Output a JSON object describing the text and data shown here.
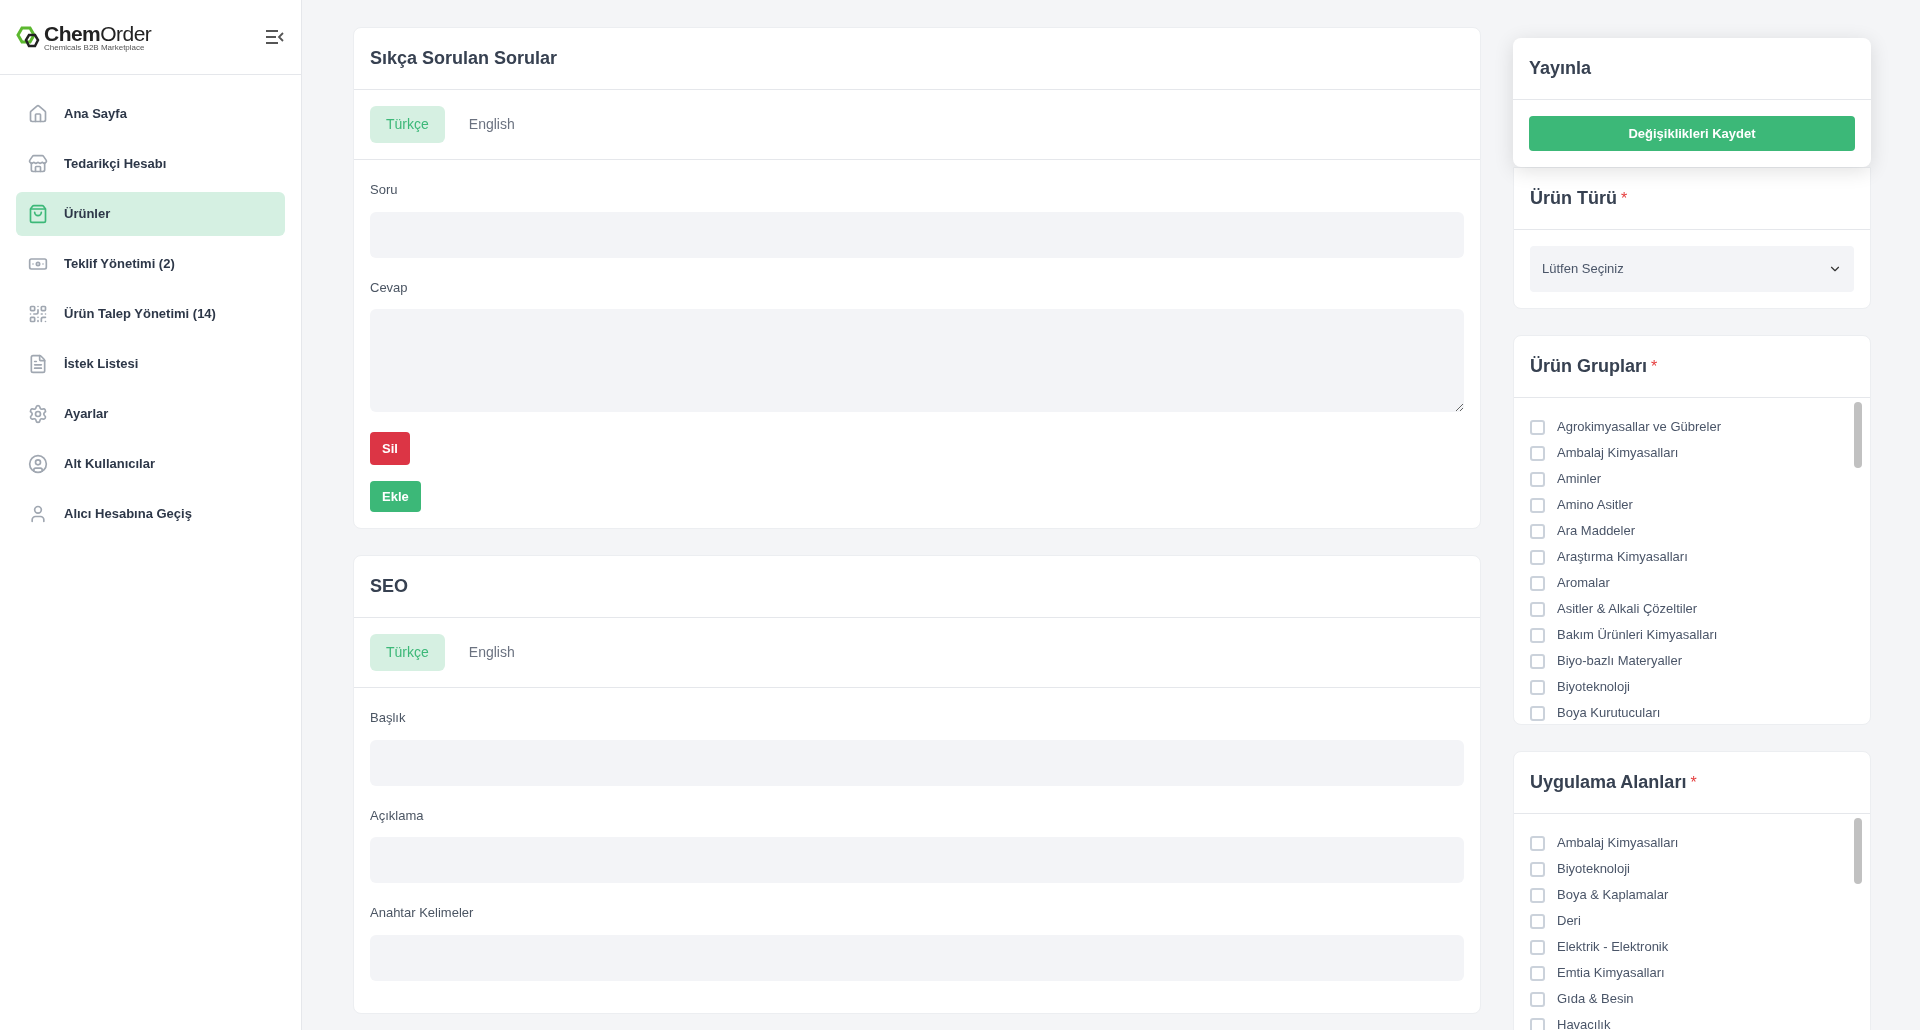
{
  "logo": {
    "name_bold": "Chem",
    "name_light": "Order",
    "tagline": "Chemicals B2B Marketplace"
  },
  "sidebar": {
    "items": [
      {
        "label": "Ana Sayfa",
        "selected": false
      },
      {
        "label": "Tedarikçi Hesabı",
        "selected": false
      },
      {
        "label": "Ürünler",
        "selected": true
      },
      {
        "label": "Teklif Yönetimi (2)",
        "selected": false
      },
      {
        "label": "Ürün Talep Yönetimi (14)",
        "selected": false
      },
      {
        "label": "İstek Listesi",
        "selected": false
      },
      {
        "label": "Ayarlar",
        "selected": false
      },
      {
        "label": "Alt Kullanıcılar",
        "selected": false
      },
      {
        "label": "Alıcı Hesabına Geçiş",
        "selected": false
      }
    ]
  },
  "faq": {
    "title": "Sıkça Sorulan Sorular",
    "tabs": [
      {
        "label": "Türkçe",
        "selected": true
      },
      {
        "label": "English",
        "selected": false
      }
    ],
    "fields": [
      {
        "label": "Soru",
        "kind": "input"
      },
      {
        "label": "Cevap",
        "kind": "textarea"
      }
    ],
    "delete_button": "Sil",
    "add_button": "Ekle"
  },
  "seo": {
    "title": "SEO",
    "tabs": [
      {
        "label": "Türkçe",
        "selected": true
      },
      {
        "label": "English",
        "selected": false
      }
    ],
    "fields": [
      {
        "label": "Başlık",
        "kind": "input"
      },
      {
        "label": "Açıklama",
        "kind": "input"
      },
      {
        "label": "Anahtar Kelimeler",
        "kind": "input"
      }
    ]
  },
  "publish": {
    "title": "Yayınla",
    "button": "Değişiklikleri Kaydet"
  },
  "product_type": {
    "title": "Ürün Türü",
    "required_mark": "*",
    "select_value": "Lütfen Seçiniz"
  },
  "product_groups": {
    "title": "Ürün Grupları",
    "required_mark": "*",
    "options": [
      {
        "label": "Agrokimyasallar ve Gübreler",
        "checked": false
      },
      {
        "label": "Ambalaj Kimyasalları",
        "checked": false
      },
      {
        "label": "Aminler",
        "checked": false
      },
      {
        "label": "Amino Asitler",
        "checked": false
      },
      {
        "label": "Ara Maddeler",
        "checked": false
      },
      {
        "label": "Araştırma Kimyasalları",
        "checked": false
      },
      {
        "label": "Aromalar",
        "checked": false
      },
      {
        "label": "Asitler & Alkali Çözeltiler",
        "checked": false
      },
      {
        "label": "Bakım Ürünleri Kimyasalları",
        "checked": false
      },
      {
        "label": "Biyo-bazlı Materyaller",
        "checked": false
      },
      {
        "label": "Biyoteknoloji",
        "checked": false
      },
      {
        "label": "Boya Kurutucuları",
        "checked": false
      }
    ]
  },
  "application_areas": {
    "title": "Uygulama Alanları",
    "required_mark": "*",
    "options": [
      {
        "label": "Ambalaj Kimyasalları",
        "checked": false
      },
      {
        "label": "Biyoteknoloji",
        "checked": false
      },
      {
        "label": "Boya & Kaplamalar",
        "checked": false
      },
      {
        "label": "Deri",
        "checked": false
      },
      {
        "label": "Elektrik - Elektronik",
        "checked": false
      },
      {
        "label": "Emtia Kimyasalları",
        "checked": false
      },
      {
        "label": "Gıda & Besin",
        "checked": false
      },
      {
        "label": "Havacılık",
        "checked": false
      }
    ]
  }
}
